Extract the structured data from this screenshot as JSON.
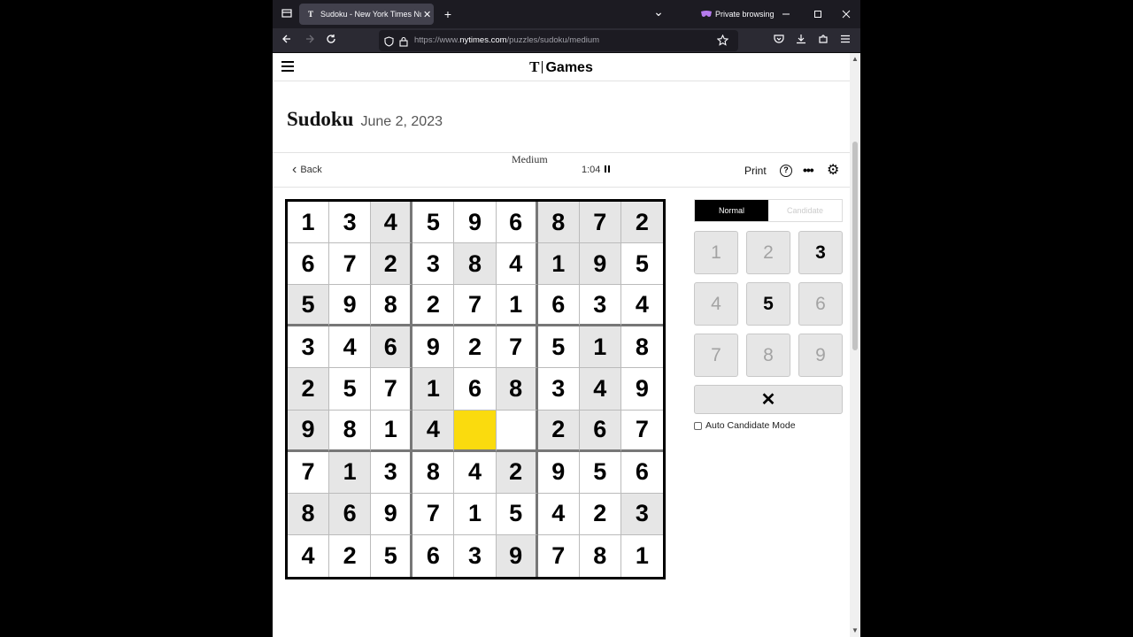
{
  "browser": {
    "tab_title": "Sudoku - New York Times Num",
    "tab_favicon": "T",
    "tab_close": "✕",
    "new_tab": "+",
    "tab_list": "⌄",
    "private_label": "Private browsing",
    "url_prefix": "https://www.",
    "url_domain": "nytimes.com",
    "url_path": "/puzzles/sudoku/medium"
  },
  "header": {
    "brand_logo": "T",
    "brand_name": "Games"
  },
  "puzzle": {
    "title": "Sudoku",
    "date": "June 2, 2023",
    "back_label": "Back",
    "difficulty": "Medium",
    "timer": "1:04",
    "print_label": "Print",
    "help_glyph": "?",
    "more_glyph": "•••",
    "settings_glyph": "⚙"
  },
  "board": {
    "values": [
      [
        "1",
        "3",
        "4",
        "5",
        "9",
        "6",
        "8",
        "7",
        "2"
      ],
      [
        "6",
        "7",
        "2",
        "3",
        "8",
        "4",
        "1",
        "9",
        "5"
      ],
      [
        "5",
        "9",
        "8",
        "2",
        "7",
        "1",
        "6",
        "3",
        "4"
      ],
      [
        "3",
        "4",
        "6",
        "9",
        "2",
        "7",
        "5",
        "1",
        "8"
      ],
      [
        "2",
        "5",
        "7",
        "1",
        "6",
        "8",
        "3",
        "4",
        "9"
      ],
      [
        "9",
        "8",
        "1",
        "4",
        "",
        "",
        "2",
        "6",
        "7"
      ],
      [
        "7",
        "1",
        "3",
        "8",
        "4",
        "2",
        "9",
        "5",
        "6"
      ],
      [
        "8",
        "6",
        "9",
        "7",
        "1",
        "5",
        "4",
        "2",
        "3"
      ],
      [
        "4",
        "2",
        "5",
        "6",
        "3",
        "9",
        "7",
        "8",
        "1"
      ]
    ],
    "given": [
      [
        0,
        0,
        1,
        0,
        0,
        0,
        1,
        1,
        1
      ],
      [
        0,
        0,
        1,
        0,
        1,
        0,
        1,
        1,
        0
      ],
      [
        1,
        0,
        0,
        0,
        0,
        0,
        0,
        0,
        0
      ],
      [
        0,
        0,
        1,
        0,
        0,
        0,
        0,
        1,
        0
      ],
      [
        1,
        0,
        0,
        1,
        0,
        1,
        0,
        1,
        0
      ],
      [
        1,
        0,
        0,
        1,
        0,
        0,
        1,
        1,
        0
      ],
      [
        0,
        1,
        0,
        0,
        0,
        1,
        0,
        0,
        0
      ],
      [
        1,
        1,
        0,
        0,
        0,
        0,
        0,
        0,
        1
      ],
      [
        0,
        0,
        0,
        0,
        0,
        1,
        0,
        0,
        0
      ]
    ],
    "selected": [
      5,
      4
    ],
    "selected_color": "#fadb0e",
    "given_color": "#e6e6e6"
  },
  "controls": {
    "mode_normal": "Normal",
    "mode_candidate": "Candidate",
    "keys": [
      "1",
      "2",
      "3",
      "4",
      "5",
      "6",
      "7",
      "8",
      "9"
    ],
    "keys_available": [
      false,
      false,
      true,
      false,
      true,
      false,
      false,
      false,
      false
    ],
    "erase_glyph": "✕",
    "auto_candidate_label": "Auto Candidate Mode"
  }
}
